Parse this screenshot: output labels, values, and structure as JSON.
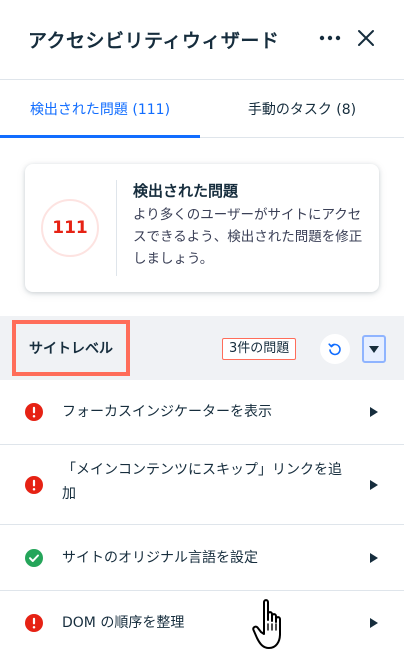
{
  "header": {
    "title": "アクセシビリティウィザード",
    "more_icon": "more-horizontal-icon",
    "close_icon": "close-icon"
  },
  "tabs": [
    {
      "label": "検出された問題 (111)",
      "active": true
    },
    {
      "label": "手動のタスク (8)",
      "active": false
    }
  ],
  "summary": {
    "count": "111",
    "title": "検出された問題",
    "description": "より多くのユーザーがサイトにアクセスできるよう、検出された問題を修正しましょう。"
  },
  "section": {
    "label": "サイトレベル",
    "issue_count": "3件の問題",
    "refresh_icon": "refresh-icon",
    "collapse_icon": "caret-down-icon"
  },
  "issues": [
    {
      "label": "フォーカスインジケーターを表示",
      "status": "error"
    },
    {
      "label": "「メインコンテンツにスキップ」リンクを追加",
      "status": "error"
    },
    {
      "label": "サイトのオリジナル言語を設定",
      "status": "success"
    },
    {
      "label": "DOM の順序を整理",
      "status": "error"
    }
  ],
  "colors": {
    "accent": "#116dff",
    "error": "#e62214",
    "success": "#25a55a",
    "highlight": "#ff6d5a",
    "section_bg": "#f0f2f5",
    "text": "#162d3d"
  }
}
